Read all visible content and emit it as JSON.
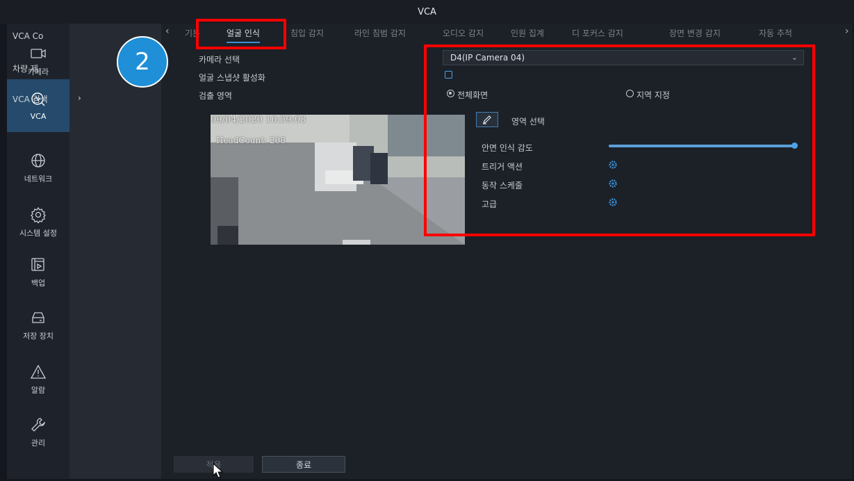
{
  "window": {
    "title": "VCA"
  },
  "rail": [
    {
      "label": "카메라",
      "icon": "camera-icon"
    },
    {
      "label": "VCA",
      "icon": "vca-icon",
      "active": true
    },
    {
      "label": "네트워크",
      "icon": "globe-icon"
    },
    {
      "label": "시스템 설정",
      "icon": "gear-icon"
    },
    {
      "label": "백업",
      "icon": "backup-icon"
    },
    {
      "label": "저장 장치",
      "icon": "storage-icon"
    },
    {
      "label": "알람",
      "icon": "alarm-icon"
    },
    {
      "label": "관리",
      "icon": "wrench-icon"
    }
  ],
  "subnav": [
    {
      "label": "VCA Co"
    },
    {
      "label": "차량 제"
    },
    {
      "label": "VCA 검색",
      "chevron": "›"
    }
  ],
  "badge": {
    "label": "2"
  },
  "tabs": [
    {
      "label": "기본"
    },
    {
      "label": "얼굴 인식",
      "active": true
    },
    {
      "label": "침입 감지"
    },
    {
      "label": "라인 침범 감지"
    },
    {
      "label": "오디오 감지"
    },
    {
      "label": "인원 집계"
    },
    {
      "label": "디 포커스 감지"
    },
    {
      "label": "장면 변경 감지"
    },
    {
      "label": "자동 추적"
    }
  ],
  "tab_arrows": {
    "left": "‹",
    "right": "›"
  },
  "form": {
    "camera_label": "카메라 선택",
    "snapshot_label": "얼굴 스냅샷 활성화",
    "detect_area_label": "검출 영역",
    "camera_value": "D4(IP Camera 04)",
    "radio_full": "전체화면",
    "radio_region": "지역 지정",
    "area_select": "영역 선택",
    "sensitivity_label": "안면 인식 감도",
    "sensitivity_value": 1.0,
    "trigger_label": "트리거 액션",
    "schedule_label": "동작 스케줄",
    "advanced_label": "고급"
  },
  "preview": {
    "timestamp": "09/04/2020 10:59:03",
    "headcount": "HeadCount: 208"
  },
  "buttons": {
    "apply": "적용",
    "exit": "종료"
  },
  "colors": {
    "accent": "#3a8fd4",
    "highlight": "#ff0000",
    "badge": "#1f8fd8"
  }
}
